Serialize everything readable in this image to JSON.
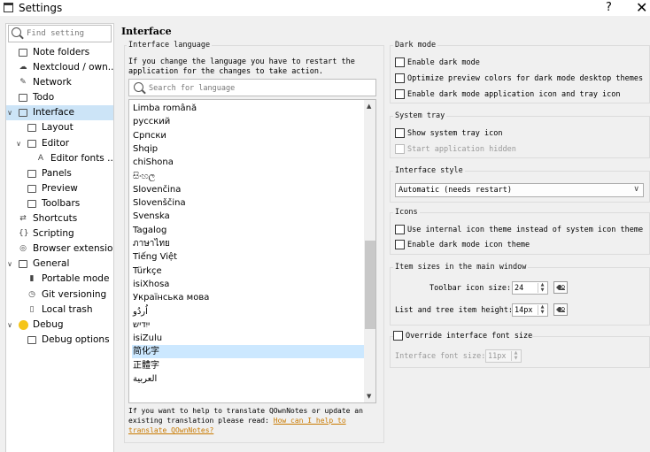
{
  "window": {
    "title": "Settings",
    "help": "?",
    "close": "✕"
  },
  "sidebar": {
    "search_placeholder": "Find setting",
    "items": [
      {
        "label": "Note folders",
        "icon": "folder-icon",
        "level": 0,
        "chevron": ""
      },
      {
        "label": "Nextcloud / own...",
        "icon": "cloud-icon",
        "level": 0,
        "chevron": ""
      },
      {
        "label": "Network",
        "icon": "network-icon",
        "level": 0,
        "chevron": ""
      },
      {
        "label": "Todo",
        "icon": "todo-icon",
        "level": 0,
        "chevron": ""
      },
      {
        "label": "Interface",
        "icon": "interface-icon",
        "level": 0,
        "chevron": "∨",
        "selected": true
      },
      {
        "label": "Layout",
        "icon": "layout-icon",
        "level": 1,
        "chevron": ""
      },
      {
        "label": "Editor",
        "icon": "editor-icon",
        "level": 1,
        "chevron": "∨"
      },
      {
        "label": "Editor fonts ...",
        "icon": "font-icon",
        "level": 2,
        "chevron": ""
      },
      {
        "label": "Panels",
        "icon": "panels-icon",
        "level": 1,
        "chevron": ""
      },
      {
        "label": "Preview",
        "icon": "preview-icon",
        "level": 1,
        "chevron": ""
      },
      {
        "label": "Toolbars",
        "icon": "toolbars-icon",
        "level": 1,
        "chevron": ""
      },
      {
        "label": "Shortcuts",
        "icon": "shortcuts-icon",
        "level": 0,
        "chevron": ""
      },
      {
        "label": "Scripting",
        "icon": "scripting-icon",
        "level": 0,
        "chevron": ""
      },
      {
        "label": "Browser extension",
        "icon": "browser-icon",
        "level": 0,
        "chevron": ""
      },
      {
        "label": "General",
        "icon": "general-icon",
        "level": 0,
        "chevron": "∨"
      },
      {
        "label": "Portable mode",
        "icon": "portable-icon",
        "level": 1,
        "chevron": ""
      },
      {
        "label": "Git versioning",
        "icon": "git-icon",
        "level": 1,
        "chevron": ""
      },
      {
        "label": "Local trash",
        "icon": "trash-icon",
        "level": 1,
        "chevron": ""
      },
      {
        "label": "Debug",
        "icon": "debug-icon",
        "level": 0,
        "chevron": "∨"
      },
      {
        "label": "Debug options",
        "icon": "debug-options-icon",
        "level": 1,
        "chevron": ""
      }
    ]
  },
  "main": {
    "heading": "Interface",
    "language": {
      "group_title": "Interface language",
      "info": "If you change the language you have to restart the\napplication for the changes to take action.",
      "search_placeholder": "Search for language",
      "items": [
        "Limba română",
        "русский",
        "Српски",
        "Shqip",
        "chiShona",
        "සිංහල",
        "Slovenčina",
        "Slovenščina",
        "Svenska",
        "Tagalog",
        "ภาษาไทย",
        "Tiếng Việt",
        "Türkçe",
        "isiXhosa",
        "Українська мова",
        "اُردُو",
        "ייִדיש",
        "isiZulu",
        "简化字",
        "正體字",
        "العربية"
      ],
      "selected_index": 18,
      "scroll_fraction": 0.68,
      "help_text": "If you want to help to translate QOwnNotes or update an",
      "help_text2": "existing translation please read: ",
      "help_link": "How can I help to",
      "help_link2": "translate QOwnNotes?"
    },
    "dark_mode": {
      "title": "Dark mode",
      "enable": "Enable dark mode",
      "optimize": "Optimize preview colors for dark mode desktop themes",
      "icon": "Enable dark mode application icon and tray icon"
    },
    "system_tray": {
      "title": "System tray",
      "show": "Show system tray icon",
      "hidden": "Start application hidden"
    },
    "interface_style": {
      "title": "Interface style",
      "value": "Automatic (needs restart)"
    },
    "icons": {
      "title": "Icons",
      "internal": "Use internal icon theme instead of system icon theme",
      "dark": "Enable dark mode icon theme"
    },
    "item_sizes": {
      "title": "Item sizes in the main window",
      "toolbar_label": "Toolbar icon size:",
      "toolbar_value": "24",
      "list_label": "List and tree item height:",
      "list_value": "14px"
    },
    "font_override": {
      "title": "Override interface font size",
      "label": "Interface font size:",
      "value": "11px"
    }
  }
}
